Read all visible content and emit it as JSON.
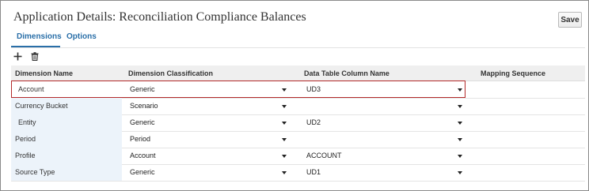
{
  "page": {
    "title": "Application Details: Reconciliation Compliance Balances"
  },
  "toolbar": {
    "save_label": "Save"
  },
  "tabs": [
    {
      "label": "Dimensions",
      "active": true
    },
    {
      "label": "Options",
      "active": false
    }
  ],
  "actions": {
    "add_icon": "plus-icon",
    "delete_icon": "trash-icon"
  },
  "table": {
    "headers": [
      "Dimension Name",
      "Dimension Classification",
      "Data Table Column Name",
      "Mapping Sequence"
    ],
    "rows": [
      {
        "name": "Account",
        "classification": "Generic",
        "column": "UD3",
        "mapping": "",
        "highlighted": true
      },
      {
        "name": "Currency Bucket",
        "classification": "Scenario",
        "column": "",
        "mapping": ""
      },
      {
        "name": "Entity",
        "classification": "Generic",
        "column": "UD2",
        "mapping": ""
      },
      {
        "name": "Period",
        "classification": "Period",
        "column": "",
        "mapping": ""
      },
      {
        "name": "Profile",
        "classification": "Account",
        "column": "ACCOUNT",
        "mapping": ""
      },
      {
        "name": "Source Type",
        "classification": "Generic",
        "column": "UD1",
        "mapping": ""
      }
    ]
  },
  "colors": {
    "accent": "#2a6fa8",
    "highlight_border": "#b32a2a",
    "name_column_bg": "#ecf3fa"
  }
}
